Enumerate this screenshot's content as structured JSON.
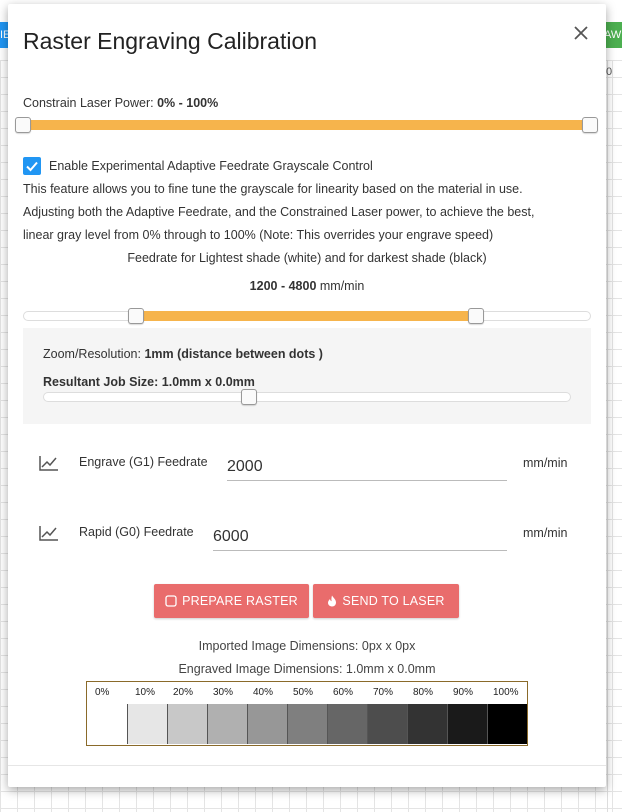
{
  "background": {
    "left_tab": "IE",
    "right_tab": "AW",
    "zero_label": "0"
  },
  "dialog": {
    "title": "Raster Engraving Calibration",
    "close_icon": "close-icon"
  },
  "laser_power": {
    "label": "Constrain Laser Power: ",
    "range_text": "0% - 100%",
    "min_percent": 0,
    "max_percent": 100
  },
  "adaptive": {
    "checkbox_checked": true,
    "checkbox_label": "Enable Experimental Adaptive Feedrate Grayscale Control",
    "description_1": "This feature allows you to fine tune the grayscale for linearity based on the material in use.",
    "description_2": "Adjusting both the Adaptive Feedrate, and the Constrained Laser power, to achieve the best,",
    "description_3": "linear gray level from 0% through to 100% (Note: This overrides your engrave speed)",
    "feedrate_caption": "Feedrate for Lightest shade (white) and for darkest shade (black)",
    "feedrate_range_text": "1200 - 4800",
    "feedrate_unit": " mm/min",
    "feedrate_low": 1200,
    "feedrate_high": 4800
  },
  "zoom": {
    "label": "Zoom/Resolution: ",
    "value_text": "1mm (distance between dots )",
    "job_size_text": "Resultant Job Size: 1.0mm x 0.0mm",
    "slider_fraction": 0.39
  },
  "engrave_feed": {
    "icon": "chart-line-icon",
    "label": "Engrave (G1) Feedrate",
    "value": "2000",
    "unit": "mm/min"
  },
  "rapid_feed": {
    "icon": "chart-line-icon",
    "label": "Rapid (G0) Feedrate",
    "value": "6000",
    "unit": "mm/min"
  },
  "buttons": {
    "prepare_label": "PREPARE RASTER",
    "prepare_icon": "square-outline-icon",
    "send_label": "SEND TO LASER",
    "send_icon": "fire-icon",
    "color": "#e96c6c"
  },
  "dimensions": {
    "imported": "Imported Image Dimensions: 0px x 0px",
    "engraved": "Engraved Image Dimensions: 1.0mm x 0.0mm"
  },
  "grayscale": {
    "labels": [
      "0%",
      "10%",
      "20%",
      "30%",
      "40%",
      "50%",
      "60%",
      "70%",
      "80%",
      "90%",
      "100%"
    ],
    "colors": [
      "#ffffff",
      "#e6e6e6",
      "#c8c8c8",
      "#b0b0b0",
      "#979797",
      "#7f7f7f",
      "#666666",
      "#4d4d4d",
      "#333333",
      "#1a1a1a",
      "#000000"
    ]
  },
  "colors": {
    "accent_orange": "#f6b44c",
    "checkbox_blue": "#2196f3"
  }
}
